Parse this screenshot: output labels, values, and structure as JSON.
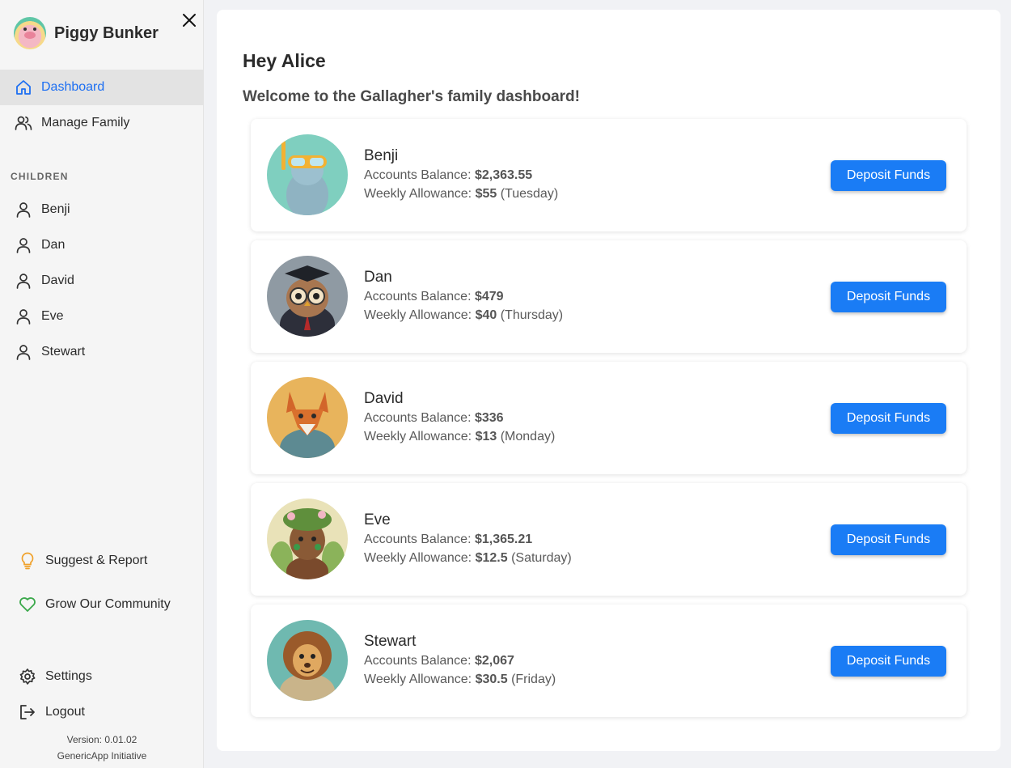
{
  "app": {
    "name": "Piggy Bunker",
    "version": "Version: 0.01.02",
    "org": "GenericApp Initiative"
  },
  "colors": {
    "accent": "#1a7cf5",
    "bulb": "#f0a12a",
    "heart": "#3aa84a"
  },
  "sidebar": {
    "nav": [
      {
        "label": "Dashboard",
        "icon": "home-icon",
        "active": true
      },
      {
        "label": "Manage Family",
        "icon": "users-icon"
      }
    ],
    "section_label": "CHILDREN",
    "children": [
      "Benji",
      "Dan",
      "David",
      "Eve",
      "Stewart"
    ],
    "extras": [
      {
        "label": "Suggest & Report",
        "icon": "lightbulb-icon"
      },
      {
        "label": "Grow Our Community",
        "icon": "heart-icon"
      }
    ],
    "bottom": [
      {
        "label": "Settings",
        "icon": "gear-icon"
      },
      {
        "label": "Logout",
        "icon": "logout-icon"
      }
    ]
  },
  "main": {
    "greeting": "Hey Alice",
    "welcome": "Welcome to the Gallagher's family dashboard!",
    "balance_label": "Accounts Balance:",
    "allowance_label": "Weekly Allowance:",
    "deposit_label": "Deposit Funds",
    "children": [
      {
        "name": "Benji",
        "balance": "$2,363.55",
        "allowance": "$55",
        "day": "(Tuesday)"
      },
      {
        "name": "Dan",
        "balance": "$479",
        "allowance": "$40",
        "day": "(Thursday)"
      },
      {
        "name": "David",
        "balance": "$336",
        "allowance": "$13",
        "day": "(Monday)"
      },
      {
        "name": "Eve",
        "balance": "$1,365.21",
        "allowance": "$12.5",
        "day": "(Saturday)"
      },
      {
        "name": "Stewart",
        "balance": "$2,067",
        "allowance": "$30.5",
        "day": "(Friday)"
      }
    ]
  }
}
